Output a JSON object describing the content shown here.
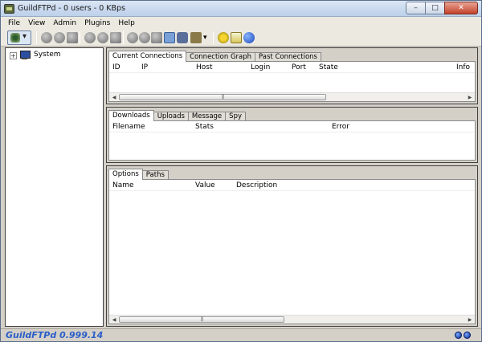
{
  "window": {
    "title": "GuildFTPd - 0 users - 0 KBps"
  },
  "menu": [
    "File",
    "View",
    "Admin",
    "Plugins",
    "Help"
  ],
  "tree": {
    "root_label": "System",
    "expander": "+"
  },
  "connections": {
    "tabs": [
      "Current Connections",
      "Connection Graph",
      "Past Connections"
    ],
    "columns": [
      "ID",
      "IP",
      "Host",
      "Login",
      "Port",
      "State",
      "Info"
    ]
  },
  "transfers": {
    "tabs": [
      "Downloads",
      "Uploads",
      "Message",
      "Spy"
    ],
    "columns": [
      "Filename",
      "Stats",
      "Error"
    ]
  },
  "settings": {
    "tabs": [
      "Options",
      "Paths"
    ],
    "columns": [
      "Name",
      "Value",
      "Description"
    ]
  },
  "status": {
    "version_text": "GuildFTPd 0.999.14"
  }
}
